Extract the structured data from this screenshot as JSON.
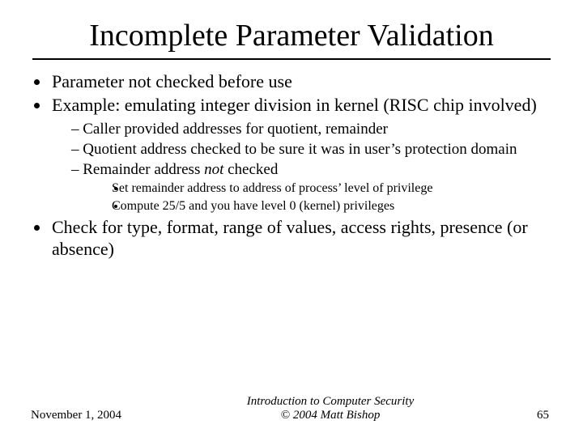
{
  "title": "Incomplete Parameter Validation",
  "bullets": {
    "b1a": "Parameter not checked before use",
    "b1b": "Example: emulating integer division in kernel (RISC chip involved)",
    "b2a": "Caller provided addresses for quotient, remainder",
    "b2b": "Quotient address checked to be sure it was in user’s protection domain",
    "b2c_pre": "Remainder address ",
    "b2c_em": "not",
    "b2c_post": " checked",
    "b3a": "Set remainder address to address of process’ level of privilege",
    "b3b": "Compute 25/5 and you have level 0 (kernel) privileges",
    "b1c": "Check for type, format, range of values, access rights, presence (or absence)"
  },
  "footer": {
    "date": "November 1, 2004",
    "center_line1": "Introduction to Computer Security",
    "center_line2": "© 2004 Matt Bishop",
    "page": "65"
  }
}
